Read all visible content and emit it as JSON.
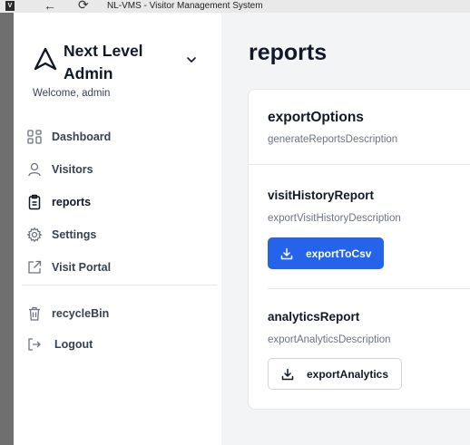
{
  "titlebar": {
    "app_icon": "V",
    "back_icon": "back-arrow-icon",
    "reload_icon": "reload-icon",
    "title": "NL-VMS - Visitor Management System"
  },
  "sidebar": {
    "brand": "Next Level Admin",
    "brand_logo_icon": "logo-icon",
    "welcome": "Welcome, admin",
    "items": [
      {
        "label": "Dashboard",
        "icon": "grid-icon"
      },
      {
        "label": "Visitors",
        "icon": "user-icon"
      },
      {
        "label": "reports",
        "icon": "clipboard-icon",
        "active": true
      },
      {
        "label": "Settings",
        "icon": "gear-icon"
      },
      {
        "label": "Visit Portal",
        "icon": "external-link-icon"
      },
      {
        "label": "recycleBin",
        "icon": "trash-icon"
      },
      {
        "label": "Logout",
        "icon": "logout-icon"
      }
    ]
  },
  "main": {
    "title": "reports",
    "card": {
      "title": "exportOptions",
      "subtitle": "generateReportsDescription",
      "sections": [
        {
          "title": "visitHistoryReport",
          "description": "exportVisitHistoryDescription",
          "button": "exportToCsv"
        },
        {
          "title": "analyticsReport",
          "description": "exportAnalyticsDescription",
          "button": "exportAnalytics"
        }
      ]
    }
  },
  "colors": {
    "accent": "#2563eb",
    "sidebar_bg": "#ffffff",
    "main_bg": "#f3f4f6"
  }
}
